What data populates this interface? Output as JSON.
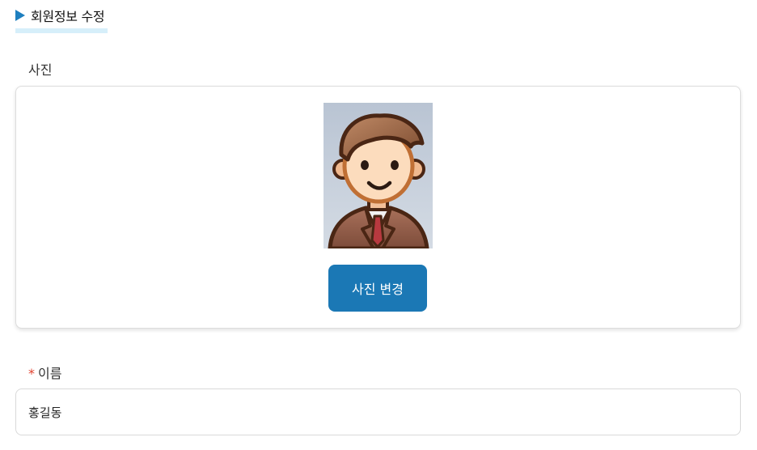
{
  "header": {
    "title": "회원정보 수정",
    "icon": "triangle-right-icon",
    "accent_color": "#1e7fbf"
  },
  "photo_section": {
    "label": "사진",
    "avatar_icon": "user-avatar-icon",
    "change_button_label": "사진 변경",
    "button_color": "#1b78b5"
  },
  "name_field": {
    "required_mark": "*",
    "label": "이름",
    "value": "홍길동"
  }
}
